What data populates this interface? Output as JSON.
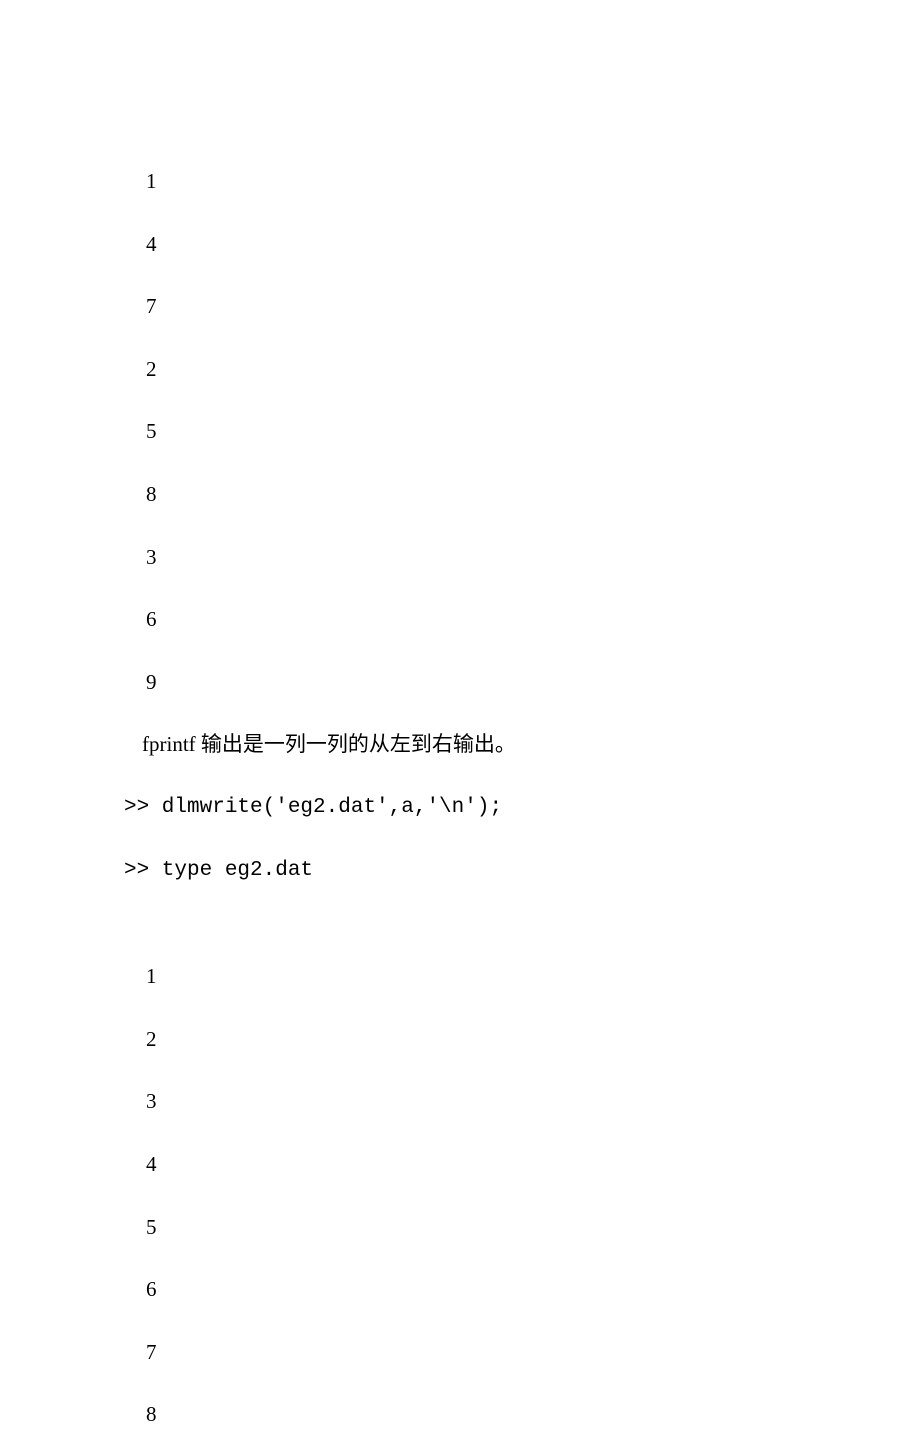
{
  "output1": {
    "values": [
      "1",
      "4",
      "7",
      "2",
      "5",
      "8",
      "3",
      "6",
      "9"
    ]
  },
  "comment": "fprintf 输出是一列一列的从左到右输出。",
  "commands": {
    "cmd1": ">> dlmwrite('eg2.dat',a,'\\n');",
    "cmd2": ">> type eg2.dat"
  },
  "output2": {
    "values": [
      "1",
      "2",
      "3",
      "4",
      "5",
      "6",
      "7",
      "8"
    ]
  }
}
